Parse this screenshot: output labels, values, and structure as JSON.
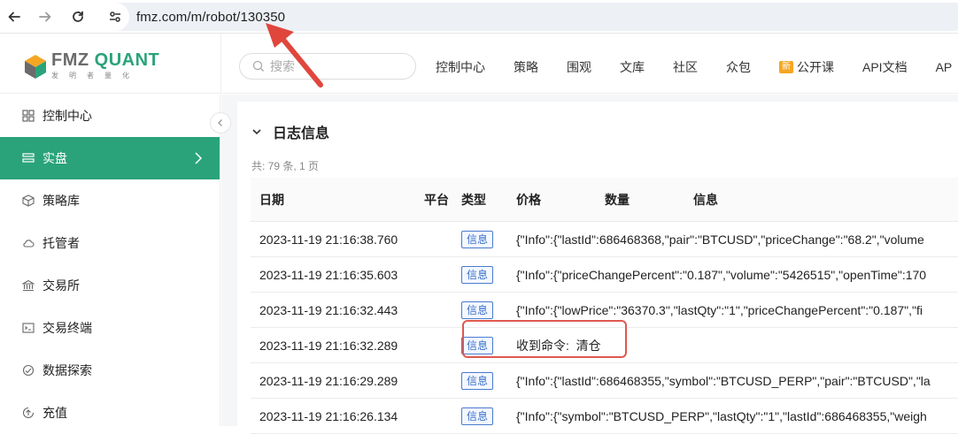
{
  "browser": {
    "url": "fmz.com/m/robot/130350"
  },
  "brand": {
    "name_part1": "FMZ",
    "name_part2": "QUANT",
    "subtitle": "发明者量化",
    "accent": "#2aa37a"
  },
  "search": {
    "placeholder": "搜索"
  },
  "topnav": [
    {
      "label": "控制中心"
    },
    {
      "label": "策略"
    },
    {
      "label": "围观"
    },
    {
      "label": "文库"
    },
    {
      "label": "社区"
    },
    {
      "label": "众包"
    },
    {
      "label": "公开课",
      "badge": "新"
    },
    {
      "label": "API文档"
    },
    {
      "label": "AP"
    }
  ],
  "sidebar": {
    "items": [
      {
        "label": "控制中心",
        "icon": "dashboard-icon"
      },
      {
        "label": "实盘",
        "icon": "list-icon",
        "active": true
      },
      {
        "label": "策略库",
        "icon": "cube-icon"
      },
      {
        "label": "托管者",
        "icon": "cloud-icon"
      },
      {
        "label": "交易所",
        "icon": "bank-icon"
      },
      {
        "label": "交易终端",
        "icon": "terminal-icon"
      },
      {
        "label": "数据探索",
        "icon": "database-icon"
      },
      {
        "label": "充值",
        "icon": "recharge-icon"
      }
    ]
  },
  "log": {
    "title": "日志信息",
    "summary": "共: 79 条, 1 页",
    "columns": {
      "date": "日期",
      "platform": "平台",
      "type": "类型",
      "price": "价格",
      "quantity": "数量",
      "info": "信息"
    },
    "rows": [
      {
        "date": "2023-11-19 21:16:38.760",
        "type": "信息",
        "info": "{\"Info\":{\"lastId\":686468368,\"pair\":\"BTCUSD\",\"priceChange\":\"68.2\",\"volume"
      },
      {
        "date": "2023-11-19 21:16:35.603",
        "type": "信息",
        "info": "{\"Info\":{\"priceChangePercent\":\"0.187\",\"volume\":\"5426515\",\"openTime\":170"
      },
      {
        "date": "2023-11-19 21:16:32.443",
        "type": "信息",
        "info": "{\"Info\":{\"lowPrice\":\"36370.3\",\"lastQty\":\"1\",\"priceChangePercent\":\"0.187\",\"fi"
      },
      {
        "date": "2023-11-19 21:16:32.289",
        "type": "信息",
        "info": "收到命令:  清仓"
      },
      {
        "date": "2023-11-19 21:16:29.289",
        "type": "信息",
        "info": "{\"Info\":{\"lastId\":686468355,\"symbol\":\"BTCUSD_PERP\",\"pair\":\"BTCUSD\",\"la"
      },
      {
        "date": "2023-11-19 21:16:26.134",
        "type": "信息",
        "info": "{\"Info\":{\"symbol\":\"BTCUSD_PERP\",\"lastQty\":\"1\",\"lastId\":686468355,\"weigh"
      }
    ]
  }
}
